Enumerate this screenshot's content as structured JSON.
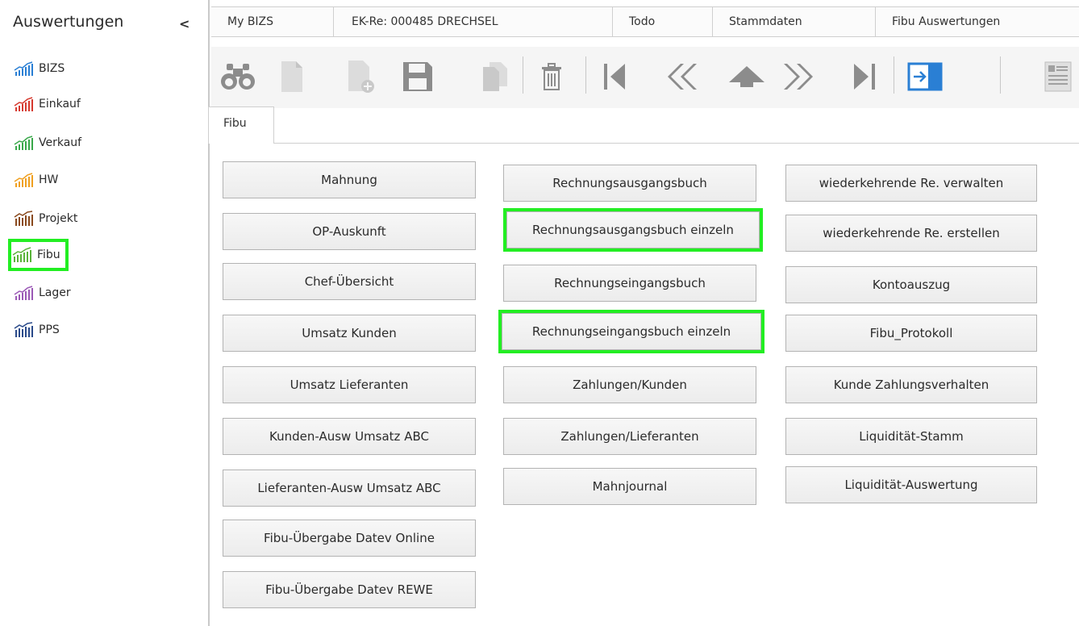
{
  "sidebar": {
    "title": "Auswertungen",
    "collapse_glyph": "<",
    "items": [
      {
        "label": "BIZS",
        "color": "#2a7fd4"
      },
      {
        "label": "Einkauf",
        "color": "#d63a2f"
      },
      {
        "label": "Verkauf",
        "color": "#3aa84a"
      },
      {
        "label": "HW",
        "color": "#f0a020"
      },
      {
        "label": "Projekt",
        "color": "#8a4a1e"
      },
      {
        "label": "Fibu",
        "color": "#5ab43a"
      },
      {
        "label": "Lager",
        "color": "#9b59b6"
      },
      {
        "label": "PPS",
        "color": "#2a4a8a"
      }
    ]
  },
  "tabs": [
    "My BIZS",
    "EK-Re: 000485 DRECHSEL",
    "Todo",
    "Stammdaten",
    "Fibu Auswertungen"
  ],
  "toolbar": {
    "icons": [
      "binoculars-icon",
      "new-document-icon",
      "add-document-icon",
      "save-icon",
      "copy-icon",
      "delete-icon",
      "first-record-icon",
      "previous-record-icon",
      "up-icon",
      "next-record-icon",
      "last-record-icon",
      "exit-icon",
      "list-view-icon"
    ]
  },
  "subtab": "Fibu",
  "columns": {
    "col1": [
      "Mahnung",
      "OP-Auskunft",
      "Chef-Übersicht",
      "Umsatz Kunden",
      "Umsatz Lieferanten",
      "Kunden-Ausw Umsatz ABC",
      "Lieferanten-Ausw Umsatz ABC",
      "Fibu-Übergabe Datev Online",
      "Fibu-Übergabe Datev REWE"
    ],
    "col2": [
      "Rechnungsausgangsbuch",
      "Rechnungsausgangsbuch einzeln",
      "Rechnungseingangsbuch",
      "Rechnungseingangsbuch einzeln",
      "Zahlungen/Kunden",
      "Zahlungen/Lieferanten",
      "Mahnjournal"
    ],
    "col3": [
      "wiederkehrende Re. verwalten",
      "wiederkehrende Re. erstellen",
      "Kontoauszug",
      "Fibu_Protokoll",
      "Kunde Zahlungsverhalten",
      "Liquidität-Stamm",
      "Liquidität-Auswertung"
    ]
  },
  "colors": {
    "highlight": "#22ee22",
    "exit_accent": "#2a7fd4",
    "icon_gray": "#8c8c8c"
  }
}
